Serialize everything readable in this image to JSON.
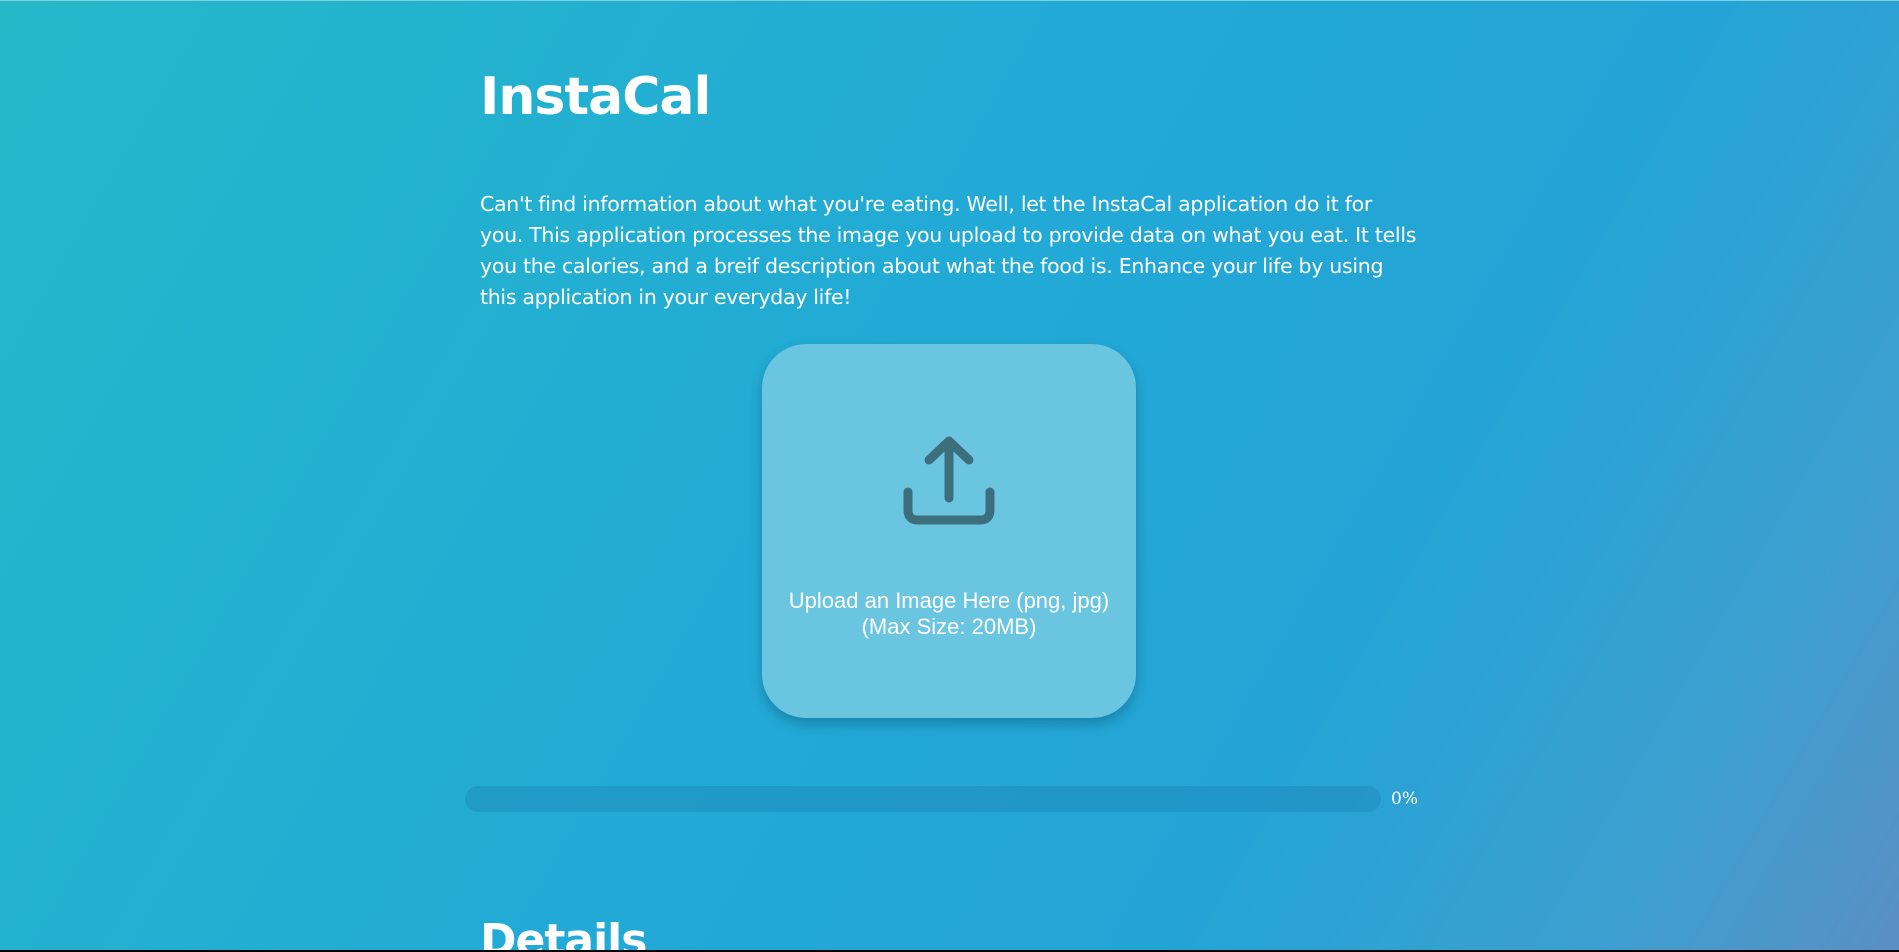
{
  "app": {
    "title": "InstaCal",
    "description": "Can't find information about what you're eating. Well, let the InstaCal application do it for you. This application processes the image you upload to provide data on what you eat. It tells you the calories, and a breif description about what the food is. Enhance your life by using this application in your everyday life!"
  },
  "upload": {
    "icon": "upload-icon",
    "line1": "Upload an Image Here (png, jpg)",
    "line2": "(Max Size: 20MB)"
  },
  "progress": {
    "value": 0,
    "label": "0%"
  },
  "details": {
    "heading": "Details"
  },
  "colors": {
    "gradient_start": "#24b8c9",
    "gradient_end": "#5a8fc4",
    "upload_box": "#6ac5e0",
    "icon": "#3d6e7c",
    "text": "#ffffff"
  }
}
